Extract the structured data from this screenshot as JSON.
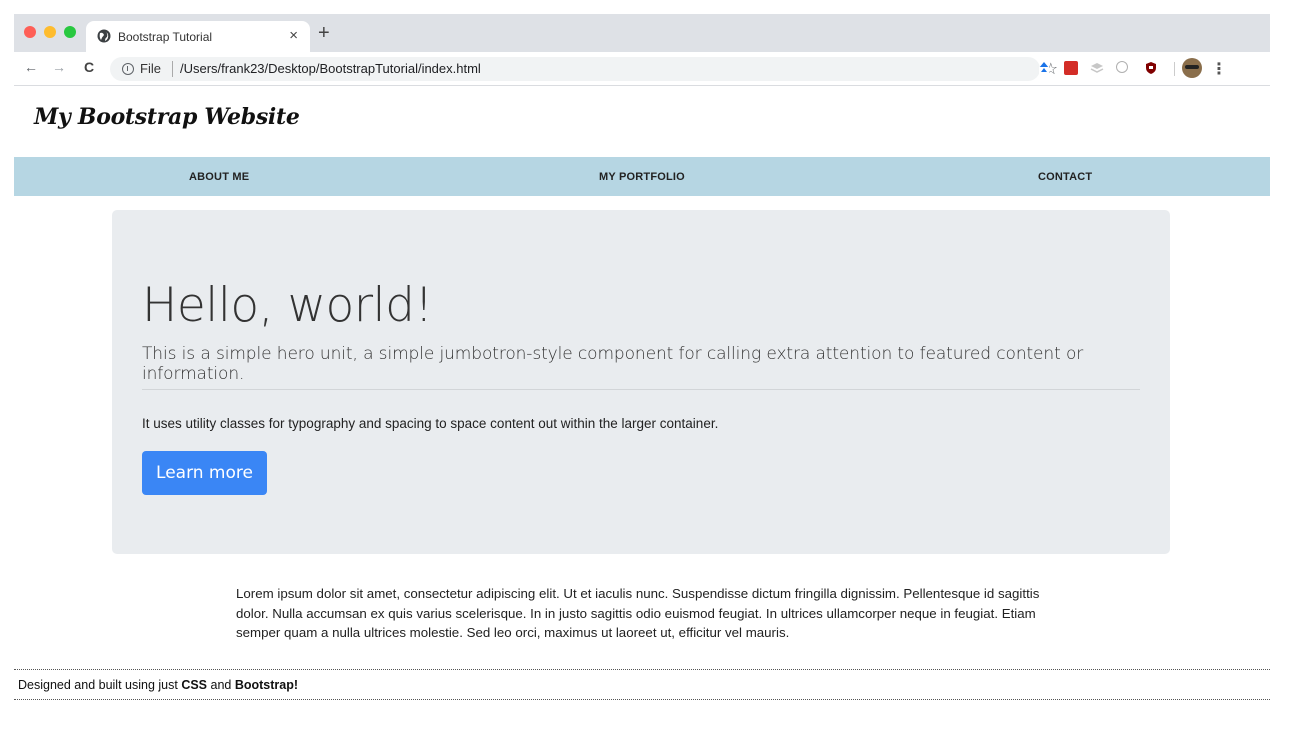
{
  "browser": {
    "tab_title": "Bootstrap Tutorial",
    "tab_close": "×",
    "new_tab": "+",
    "back": "←",
    "forward": "→",
    "reload": "C",
    "url_scheme": "File",
    "url_path": "/Users/frank23/Desktop/BootstrapTutorial/index.html",
    "bookmark_star": "☆",
    "menu": "⋮"
  },
  "page": {
    "brand": "My Bootstrap Website",
    "nav": {
      "about": "ABOUT ME",
      "portfolio": "MY PORTFOLIO",
      "contact": "CONTACT"
    },
    "hero": {
      "title": "Hello, world!",
      "lead": "This is a simple hero unit, a simple jumbotron-style component for calling extra attention to featured content or information.",
      "text": "It uses utility classes for typography and spacing to space content out within the larger container.",
      "button": "Learn more"
    },
    "lorem": "Lorem ipsum dolor sit amet, consectetur adipiscing elit. Ut et iaculis nunc. Suspendisse dictum fringilla dignissim. Pellentesque id sagittis dolor. Nulla accumsan ex quis varius scelerisque. In in justo sagittis odio euismod feugiat. In ultrices ullamcorper neque in feugiat. Etiam semper quam a nulla ultrices molestie. Sed leo orci, maximus ut laoreet ut, efficitur vel mauris.",
    "footer": {
      "prefix": "Designed and built using just ",
      "css": "CSS",
      "and": " and ",
      "bootstrap": "Bootstrap!"
    }
  },
  "colors": {
    "navbar_bg": "#b6d6e3",
    "jumbotron_bg": "#e9ecef",
    "button_bg": "#3a86f5"
  },
  "icons": [
    "globe-icon",
    "info-icon",
    "star-icon",
    "extension-pin-icon",
    "lastpass-icon",
    "layers-icon",
    "search-extension-icon",
    "ublock-icon",
    "avatar",
    "kebab-menu-icon"
  ]
}
